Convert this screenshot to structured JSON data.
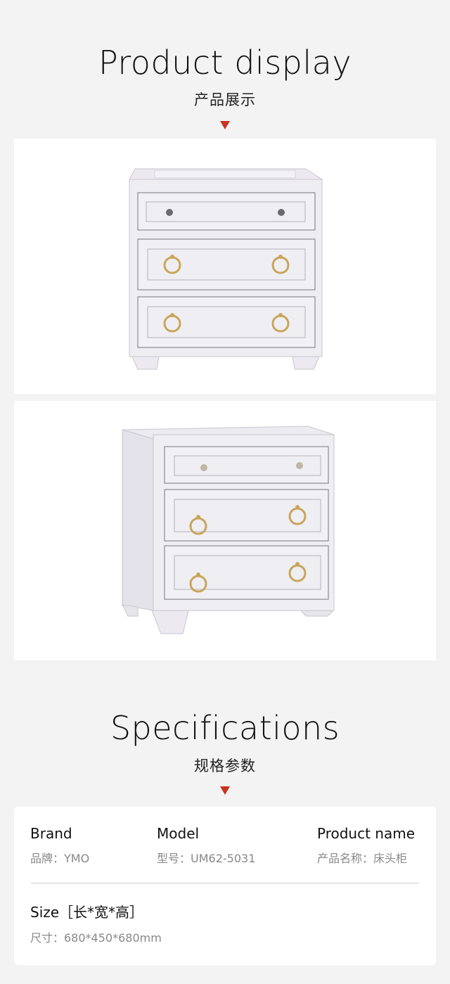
{
  "display": {
    "title": "Product display",
    "subtitle": "产品展示"
  },
  "specs": {
    "title": "Specifications",
    "subtitle": "规格参数",
    "brand": {
      "label": "Brand",
      "value": "品牌：YMO"
    },
    "model": {
      "label": "Model",
      "value": "型号：UM62-5031"
    },
    "product_name": {
      "label": "Product name",
      "value": "产品名称：床头柜"
    },
    "size": {
      "label": "Size［长*宽*高］",
      "value": "尺寸：680*450*680mm"
    }
  },
  "colors": {
    "accent": "#c8331f",
    "page_bg": "#f3f3f3",
    "card_bg": "#ffffff"
  }
}
